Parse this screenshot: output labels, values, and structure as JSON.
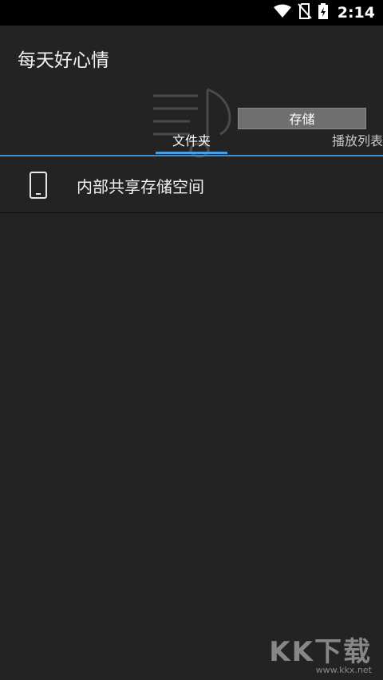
{
  "status_bar": {
    "time": "2:14",
    "icons": [
      "wifi-icon",
      "no-sim-icon",
      "battery-charging-icon"
    ]
  },
  "app_bar": {
    "title": "每天好心情",
    "storage_button_label": "存储"
  },
  "tabs": [
    {
      "label": "文件夹",
      "selected": true
    },
    {
      "label": "播放列表",
      "selected": false
    }
  ],
  "list": {
    "items": [
      {
        "label": "内部共享存储空间",
        "icon": "phone-icon"
      }
    ]
  },
  "watermark": {
    "logo": "KK下载",
    "url": "www.kkx.net"
  },
  "colors": {
    "background": "#232323",
    "status_bar": "#000000",
    "accent": "#4a9fe0"
  }
}
